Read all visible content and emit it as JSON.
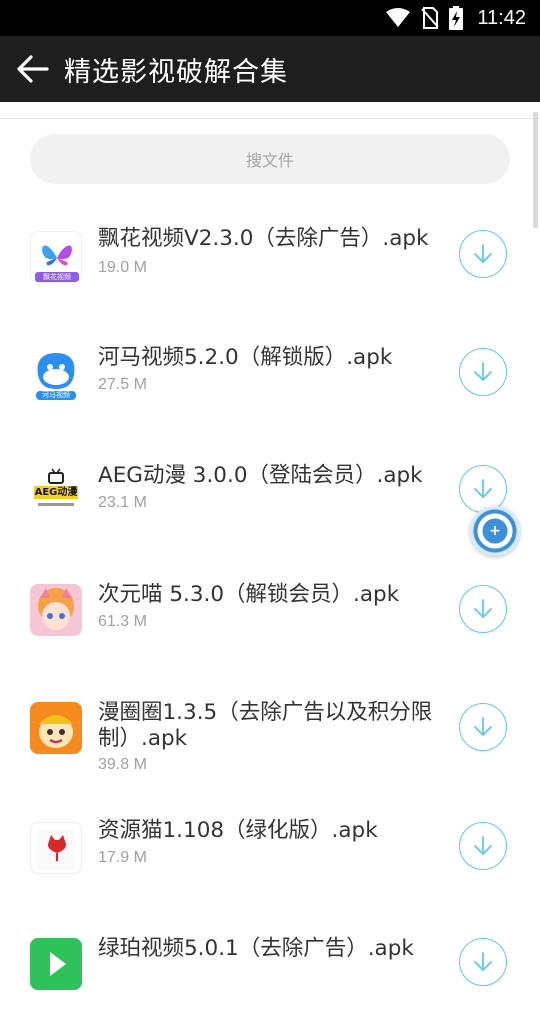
{
  "status_bar": {
    "time": "11:42",
    "icons": [
      "wifi-icon",
      "no-sim-icon",
      "battery-charging-icon"
    ]
  },
  "app_bar": {
    "back_icon": "arrow-left-icon",
    "title": "精选影视破解合集"
  },
  "search": {
    "placeholder": "搜文件"
  },
  "files": [
    {
      "name": "飘花视频V2.3.0（去除广告）.apk",
      "size": "19.0 M",
      "icon": "piaohua-app-icon",
      "icon_label": "飘花视频"
    },
    {
      "name": "河马视频5.2.0（解锁版）.apk",
      "size": "27.5 M",
      "icon": "hema-app-icon",
      "icon_label": "河马视频"
    },
    {
      "name": "AEG动漫 3.0.0（登陆会员）.apk",
      "size": "23.1 M",
      "icon": "aeg-app-icon",
      "icon_label": "AEG动漫"
    },
    {
      "name": "次元喵 5.3.0（解锁会员）.apk",
      "size": "61.3 M",
      "icon": "ciyuanmiao-app-icon"
    },
    {
      "name": "漫圈圈1.3.5（去除广告以及积分限制）.apk",
      "size": "39.8 M",
      "icon": "manquanquan-app-icon"
    },
    {
      "name": "资源猫1.108（绿化版）.apk",
      "size": "17.9 M",
      "icon": "ziyuanmao-app-icon"
    },
    {
      "name": "绿珀视频5.0.1（去除广告）.apk",
      "size": "",
      "icon": "lvpo-app-icon"
    }
  ],
  "download_icon": "download-arrow-icon",
  "floating_button_icon": "plus-icon",
  "colors": {
    "app_bar": "#1e1e1e",
    "accent": "#5ec8ee",
    "text": "#333333",
    "subtext": "#a0a0a0"
  }
}
